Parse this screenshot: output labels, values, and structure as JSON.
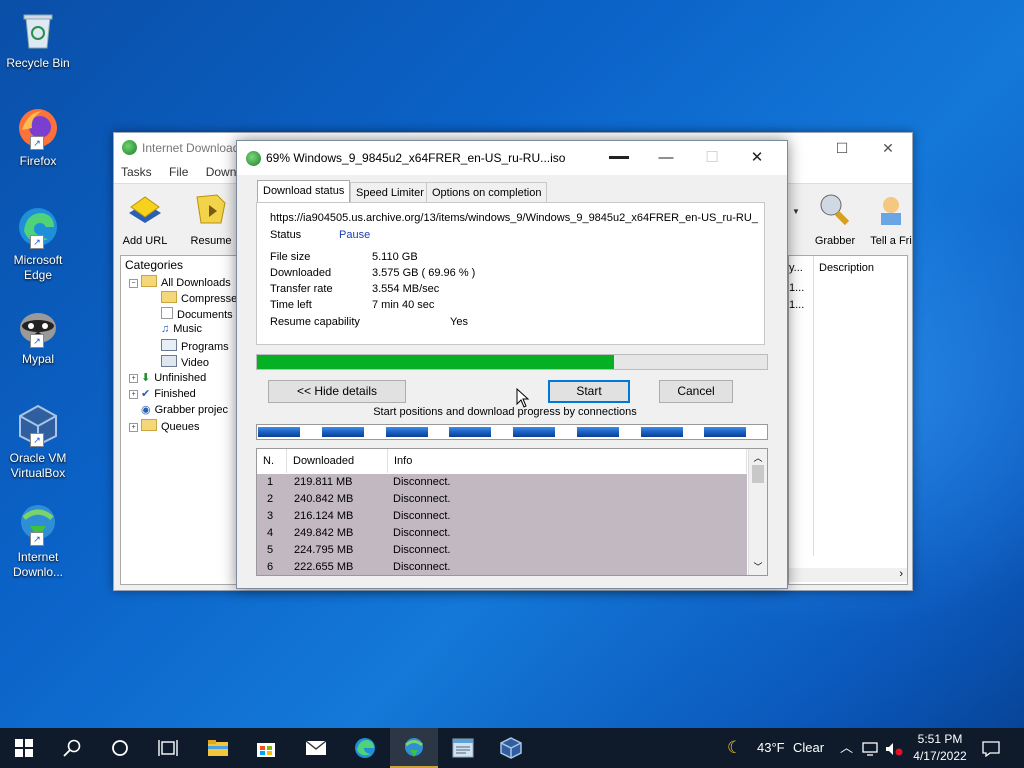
{
  "desktop": {
    "icons": [
      {
        "label": "Recycle Bin",
        "icon": "recycle-bin-icon"
      },
      {
        "label": "Firefox",
        "icon": "firefox-icon"
      },
      {
        "label": "Microsoft Edge",
        "icon": "edge-icon"
      },
      {
        "label": "Mypal",
        "icon": "mypal-icon"
      },
      {
        "label": "Oracle VM VirtualBox",
        "icon": "virtualbox-icon"
      },
      {
        "label": "Internet Downlo...",
        "icon": "idm-icon"
      }
    ]
  },
  "idm_main": {
    "title": "Internet Download Manager",
    "menu": [
      "Tasks",
      "File",
      "Downloads"
    ],
    "toolbar": [
      {
        "label": "Add URL",
        "icon": "add-url-icon"
      },
      {
        "label": "Resume",
        "icon": "resume-icon"
      },
      {
        "label": "Grabber",
        "icon": "grabber-icon"
      },
      {
        "label": "Tell a Fri",
        "icon": "tell-friend-icon"
      }
    ],
    "categories_header": "Categories",
    "tree": {
      "all_downloads": "All Downloads",
      "compressed": "Compresse",
      "documents": "Documents",
      "music": "Music",
      "programs": "Programs",
      "video": "Video",
      "unfinished": "Unfinished",
      "finished": "Finished",
      "grabber_projects": "Grabber projec",
      "queues": "Queues"
    },
    "list_columns": {
      "col1": "y...",
      "description": "Description"
    },
    "list_rows": [
      "1...",
      "1..."
    ]
  },
  "dialog": {
    "title": "69% Windows_9_9845u2_x64FRER_en-US_ru-RU...iso",
    "tabs": [
      "Download status",
      "Speed Limiter",
      "Options on completion"
    ],
    "url": "https://ia904505.us.archive.org/13/items/windows_9/Windows_9_9845u2_x64FRER_en-US_ru-RU_",
    "status_label": "Status",
    "status_value": "Pause",
    "fields": [
      {
        "label": "File size",
        "value": "5.110  GB"
      },
      {
        "label": "Downloaded",
        "value": "3.575  GB  ( 69.96 % )"
      },
      {
        "label": "Transfer rate",
        "value": "3.554  MB/sec"
      },
      {
        "label": "Time left",
        "value": "7 min 40 sec"
      }
    ],
    "resume_label": "Resume capability",
    "resume_value": "Yes",
    "progress_fraction": 0.6996,
    "buttons": {
      "hide_details": "<< Hide details",
      "start": "Start",
      "cancel": "Cancel"
    },
    "connections_caption": "Start positions and download progress by connections",
    "connection_segments": 8,
    "table_headers": {
      "n": "N.",
      "downloaded": "Downloaded",
      "info": "Info"
    },
    "table_rows": [
      {
        "n": "1",
        "downloaded": "219.811  MB",
        "info": "Disconnect."
      },
      {
        "n": "2",
        "downloaded": "240.842  MB",
        "info": "Disconnect."
      },
      {
        "n": "3",
        "downloaded": "216.124  MB",
        "info": "Disconnect."
      },
      {
        "n": "4",
        "downloaded": "249.842  MB",
        "info": "Disconnect."
      },
      {
        "n": "5",
        "downloaded": "224.795  MB",
        "info": "Disconnect."
      },
      {
        "n": "6",
        "downloaded": "222.655  MB",
        "info": "Disconnect."
      }
    ]
  },
  "taskbar": {
    "weather_temp": "43°F",
    "weather_text": "Clear",
    "time": "5:51 PM",
    "date": "4/17/2022"
  },
  "colors": {
    "progress": "#06b025",
    "accent": "#0078d7",
    "row_bg": "#c2b8c2"
  }
}
